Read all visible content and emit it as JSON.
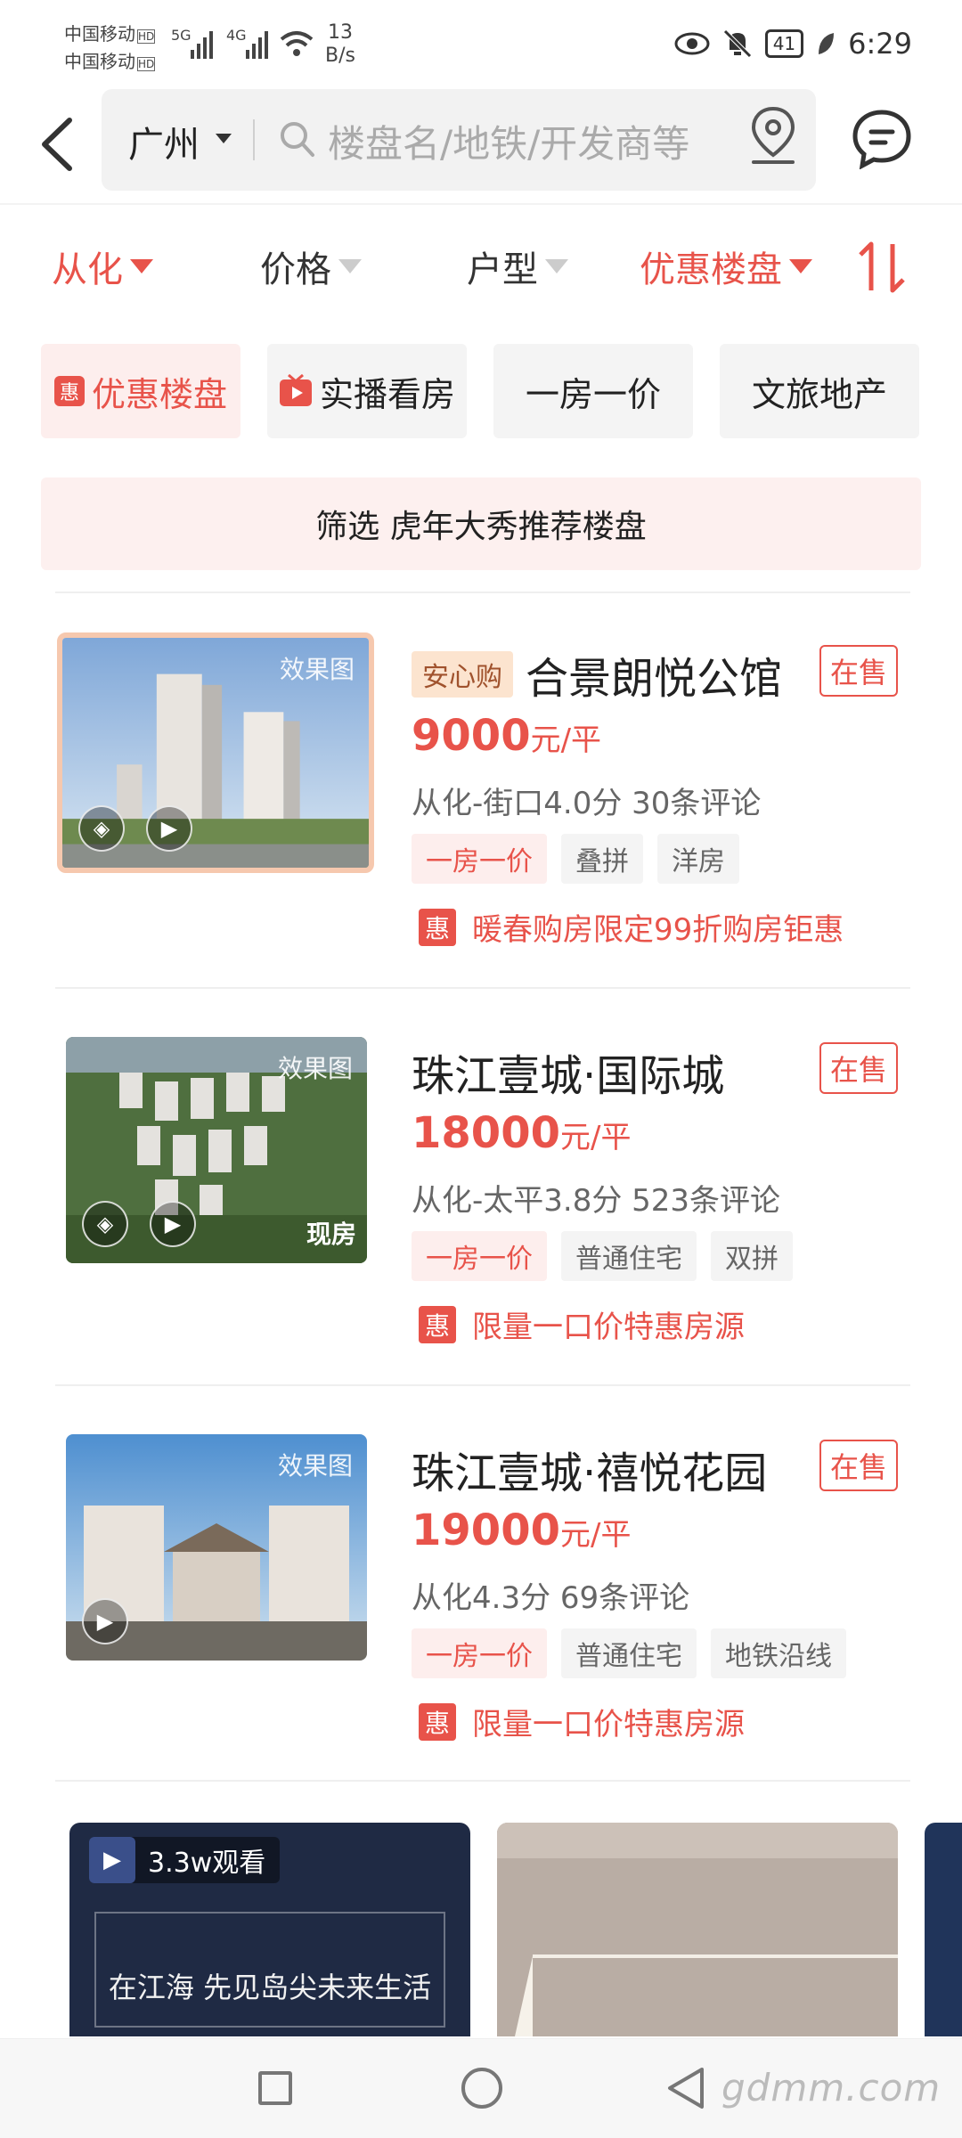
{
  "status_bar": {
    "carrier1": "中国移动",
    "carrier2": "中国移动",
    "hd": "HD",
    "net1": "5G",
    "net2": "4G",
    "speed_value": "13",
    "speed_unit": "B/s",
    "battery": "41",
    "time": "6:29"
  },
  "header": {
    "city": "广州",
    "search_placeholder": "楼盘名/地铁/开发商等"
  },
  "filters": [
    {
      "label": "从化",
      "active": true
    },
    {
      "label": "价格",
      "active": false
    },
    {
      "label": "户型",
      "active": false
    },
    {
      "label": "优惠楼盘",
      "active": true
    }
  ],
  "quick_tags": [
    {
      "label": "优惠楼盘",
      "icon": "惠",
      "active": true
    },
    {
      "label": "实播看房",
      "icon": "tv-icon",
      "active": false
    },
    {
      "label": "一房一价",
      "active": false
    },
    {
      "label": "文旅地产",
      "active": false
    }
  ],
  "banner": "筛选 虎年大秀推荐楼盘",
  "listings": [
    {
      "badge": "安心购",
      "title": "合景朗悦公馆",
      "status": "在售",
      "price": "9000",
      "price_unit": "元/平",
      "meta": "从化-街口4.0分 30条评论",
      "tags": [
        "一房一价",
        "叠拼",
        "洋房"
      ],
      "promo": "暖春购房限定99折购房钜惠",
      "thumb_label": "效果图"
    },
    {
      "title": "珠江壹城·国际城",
      "status": "在售",
      "price": "18000",
      "price_unit": "元/平",
      "meta": "从化-太平3.8分 523条评论",
      "tags": [
        "一房一价",
        "普通住宅",
        "双拼"
      ],
      "promo": "限量一口价特惠房源",
      "thumb_label": "效果图",
      "thumb_badge": "现房"
    },
    {
      "title": "珠江壹城·禧悦花园",
      "status": "在售",
      "price": "19000",
      "price_unit": "元/平",
      "meta": "从化4.3分 69条评论",
      "tags": [
        "一房一价",
        "普通住宅",
        "地铁沿线"
      ],
      "promo": "限量一口价特惠房源",
      "thumb_label": "效果图"
    }
  ],
  "promo_icon": "惠",
  "live": {
    "views": "3.3w观看",
    "caption": "在江海 先见岛尖未来生活"
  },
  "watermark": "gdmm.com"
}
